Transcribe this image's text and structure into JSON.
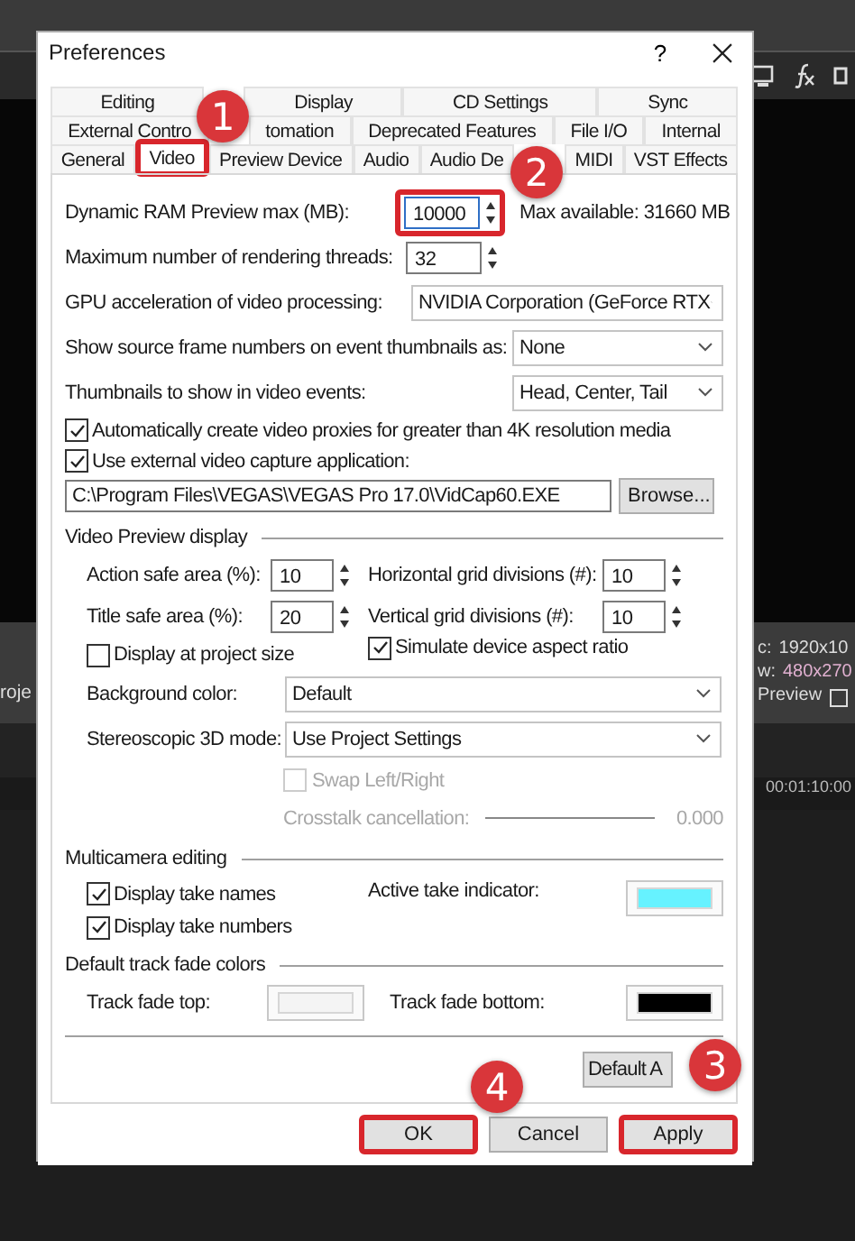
{
  "background": {
    "left_label": "roje",
    "size_label": "c:",
    "size_value": "1920x10",
    "preview_label": "w:",
    "preview_value": "480x270",
    "preview_text": "Preview",
    "timecode": "00:01:10:00"
  },
  "window": {
    "title": "Preferences",
    "help": "?"
  },
  "tab_rows": [
    {
      "tabs": [
        {
          "label": "Editing",
          "selected": false,
          "highlighted": false
        },
        {
          "label": "Display",
          "selected": false,
          "highlighted": false
        },
        {
          "label": "CD Settings",
          "selected": false,
          "highlighted": false
        },
        {
          "label": "Sync",
          "selected": false,
          "highlighted": false
        }
      ]
    },
    {
      "tabs": [
        {
          "label": "External Contro",
          "selected": false,
          "highlighted": false
        },
        {
          "label": "tomation",
          "selected": false,
          "highlighted": false
        },
        {
          "label": "Deprecated Features",
          "selected": false,
          "highlighted": false
        },
        {
          "label": "File I/O",
          "selected": false,
          "highlighted": false
        },
        {
          "label": "Internal",
          "selected": false,
          "highlighted": false
        }
      ]
    },
    {
      "tabs": [
        {
          "label": "General",
          "selected": false,
          "highlighted": false
        },
        {
          "label": "Video",
          "selected": true,
          "highlighted": true
        },
        {
          "label": "Preview Device",
          "selected": false,
          "highlighted": false
        },
        {
          "label": "Audio",
          "selected": false,
          "highlighted": false
        },
        {
          "label": "Audio De",
          "selected": false,
          "highlighted": false
        },
        {
          "label": "MIDI",
          "selected": false,
          "highlighted": false
        },
        {
          "label": "VST Effects",
          "selected": false,
          "highlighted": false
        }
      ]
    }
  ],
  "rows": [
    {
      "kind": "spin",
      "label": "Dynamic RAM Preview max (MB):",
      "value": "10000",
      "note": "Max available: 31660 MB",
      "highlighted": true
    },
    {
      "kind": "spin",
      "label": "Maximum number of rendering threads:",
      "value": "32",
      "highlighted": false
    },
    {
      "kind": "select",
      "label": "GPU acceleration of video processing:",
      "value": "NVIDIA Corporation (GeForce RTX"
    },
    {
      "kind": "select",
      "label": "Show source frame numbers on event thumbnails as:",
      "value": "None"
    },
    {
      "kind": "select",
      "label": "Thumbnails to show in video events:",
      "value": "Head, Center, Tail"
    },
    {
      "kind": "check",
      "label": "Automatically create video proxies for greater than 4K resolution media",
      "checked": true
    },
    {
      "kind": "check",
      "label": "Use external video capture application:",
      "checked": true
    },
    {
      "kind": "path",
      "value": "C:\\Program Files\\VEGAS\\VEGAS Pro 17.0\\VidCap60.EXE",
      "button": "Browse..."
    }
  ],
  "video_preview": {
    "title": "Video Preview display",
    "spins": [
      {
        "label": "Action safe area (%):",
        "value": "10"
      },
      {
        "label": "Horizontal grid divisions (#):",
        "value": "10"
      },
      {
        "label": "Title safe area (%):",
        "value": "20"
      },
      {
        "label": "Vertical grid divisions (#):",
        "value": "10"
      }
    ],
    "checks": [
      {
        "label": "Display at project size",
        "checked": false
      },
      {
        "label": "Simulate device aspect ratio",
        "checked": true
      }
    ],
    "selects": [
      {
        "label": "Background color:",
        "value": "Default"
      },
      {
        "label": "Stereoscopic 3D mode:",
        "value": "Use Project Settings"
      }
    ],
    "swap": {
      "label": "Swap Left/Right",
      "checked": false,
      "disabled": true
    },
    "crosstalk": {
      "label": "Crosstalk cancellation:",
      "value": "0.000",
      "disabled": true
    }
  },
  "multicamera": {
    "title": "Multicamera editing",
    "checks": [
      {
        "label": "Display take names",
        "checked": true
      },
      {
        "label": "Display take numbers",
        "checked": true
      }
    ],
    "indicator": {
      "label": "Active take indicator:",
      "color": "#66f2ff"
    }
  },
  "track_fade": {
    "title": "Default track fade colors",
    "swatches": [
      {
        "label": "Track fade top:",
        "color": "#f4f4f4"
      },
      {
        "label": "Track fade bottom:",
        "color": "#000000"
      }
    ]
  },
  "default_button": "Default A",
  "buttons": [
    {
      "label": "OK",
      "highlighted": true
    },
    {
      "label": "Cancel",
      "highlighted": false
    },
    {
      "label": "Apply",
      "highlighted": true
    }
  ],
  "callouts": [
    "1",
    "2",
    "3",
    "4"
  ]
}
